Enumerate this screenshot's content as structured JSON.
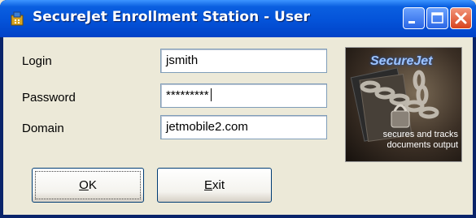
{
  "window": {
    "title": "SecureJet Enrollment Station - User",
    "controls": [
      "minimize-icon",
      "maximize-icon",
      "close-icon"
    ]
  },
  "form": {
    "login": {
      "label": "Login",
      "value": "jsmith"
    },
    "password": {
      "label": "Password",
      "value": "*********"
    },
    "domain": {
      "label": "Domain",
      "value": "jetmobile2.com"
    }
  },
  "buttons": {
    "ok": {
      "label": "OK",
      "mnemonic": "O",
      "rest": "K"
    },
    "exit": {
      "label": "Exit",
      "mnemonic": "E",
      "rest": "xit"
    }
  },
  "logo": {
    "name": "SecureJet",
    "tagline_1": "secures and tracks",
    "tagline_2": "documents output"
  },
  "colors": {
    "titlebar": "#0453d9",
    "close_button": "#d9441e",
    "face": "#ece9d8",
    "input_border": "#7f9db9"
  }
}
